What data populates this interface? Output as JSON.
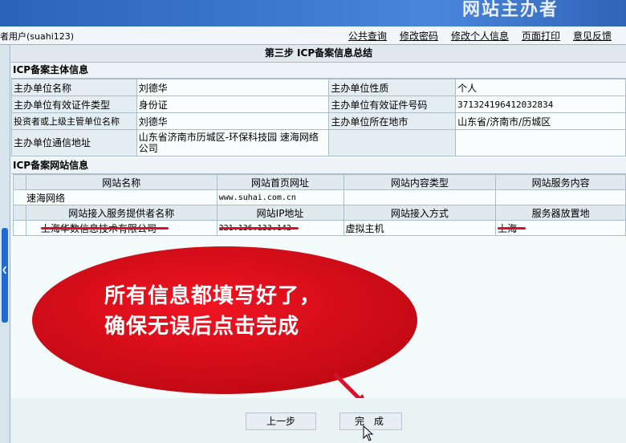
{
  "header": {
    "title": "网站主办者"
  },
  "topbar": {
    "user": "者用户(suahi123)",
    "links": [
      "公共查询",
      "修改密码",
      "修改个人信息",
      "页面打印",
      "意见反馈"
    ]
  },
  "step_title": "第三步  ICP备案信息总结",
  "subject": {
    "section_title": "ICP备案主体信息",
    "rows": [
      {
        "label1": "主办单位名称",
        "value1": "刘德华",
        "label2": "主办单位性质",
        "value2": "个人"
      },
      {
        "label1": "主办单位有效证件类型",
        "value1": "身份证",
        "label2": "主办单位有效证件号码",
        "value2": "371324196412032834"
      },
      {
        "label1": "投资者或上级主管单位名称",
        "value1": "刘德华",
        "label2": "主办单位所在地市",
        "value2": "山东省/济南市/历城区"
      },
      {
        "label1": "主办单位通信地址",
        "value1": "山东省济南市历城区-环保科技园 速海网络公司",
        "label2": "",
        "value2": ""
      }
    ]
  },
  "website": {
    "section_title": "ICP备案网站信息",
    "headers": [
      "网站名称",
      "网站首页网址",
      "网站内容类型",
      "网站服务内容"
    ],
    "row": [
      "速海网络",
      "www.suhai.com.cn",
      "",
      ""
    ],
    "access_headers": [
      "网站接入服务提供者名称",
      "网站IP地址",
      "网站接入方式",
      "服务器放置地"
    ],
    "access_row": [
      "上海华数信息技术有限公司",
      "221.136.133.142",
      "虚拟主机",
      "上海"
    ]
  },
  "callout": {
    "line1": "所有信息都填写好了，",
    "line2": "确保无误后点击完成"
  },
  "buttons": {
    "prev": "上一步",
    "finish": "完 成"
  },
  "colors": {
    "banner": "#3e78cf",
    "callout": "#e0101e",
    "strike": "#d8102a"
  },
  "icons": [
    "cursor-arrow-icon",
    "collapse-handle-icon"
  ]
}
